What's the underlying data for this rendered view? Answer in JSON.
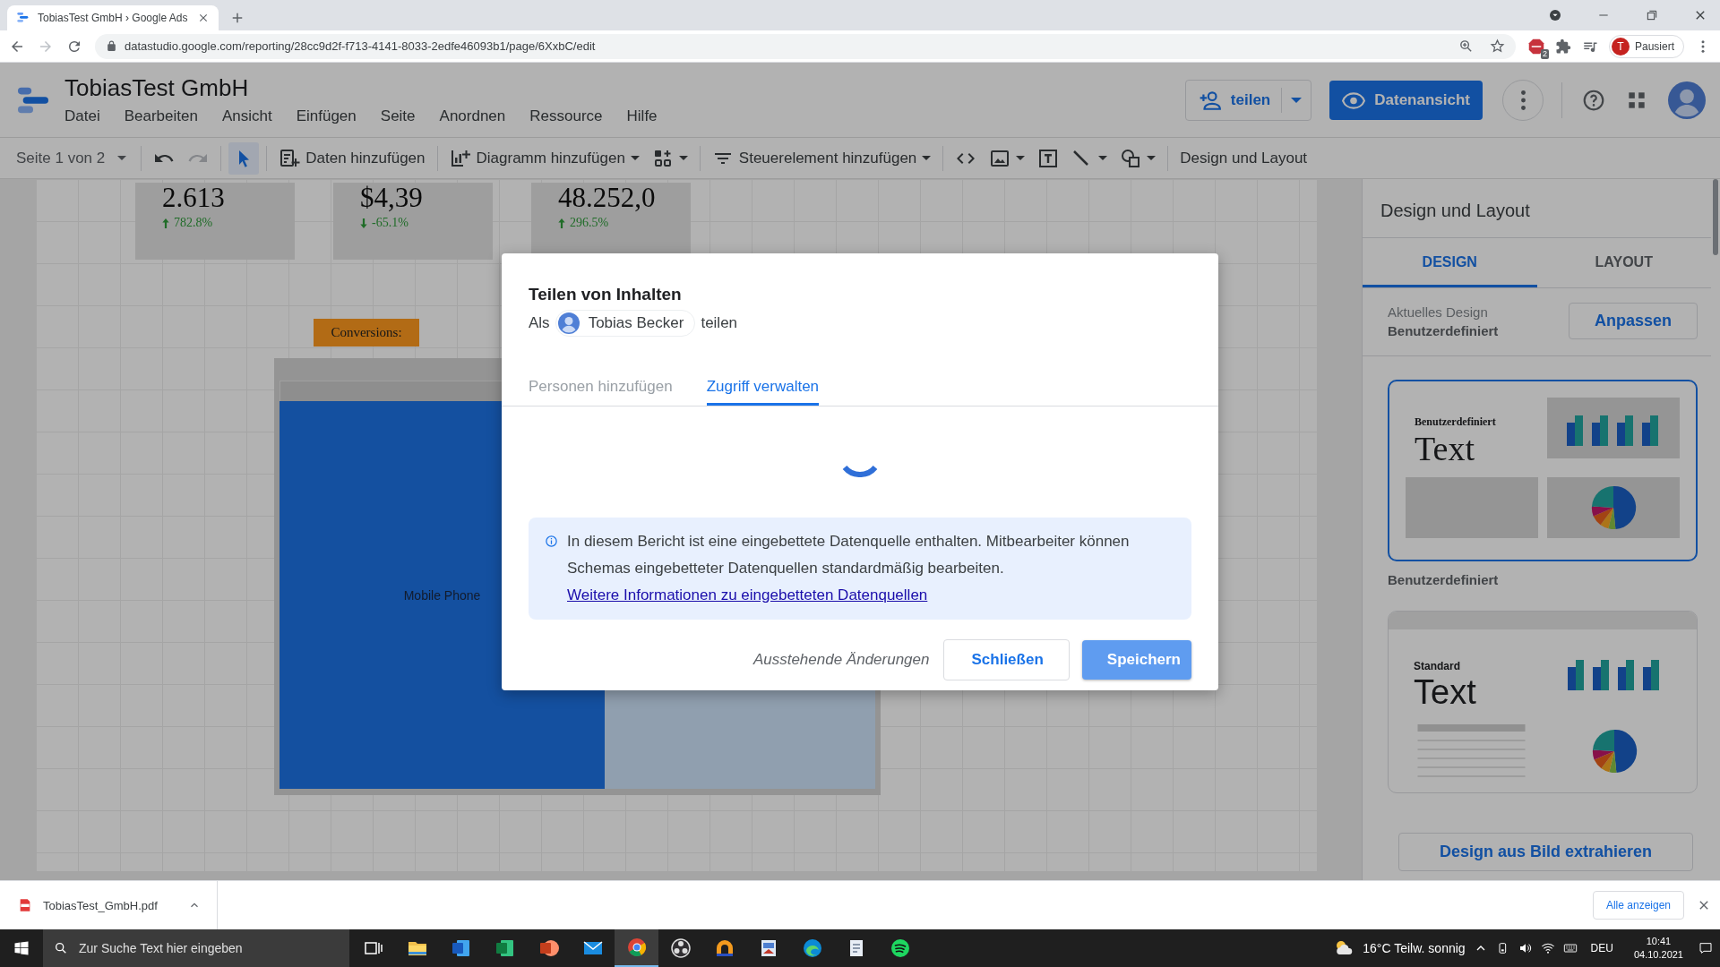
{
  "browser": {
    "tabs": [
      {
        "title": "TobiasTest GmbH › Google Ads",
        "selected": true
      }
    ],
    "url": "datastudio.google.com/reporting/28cc9d2f-f713-4141-8033-2edfe46093b1/page/6XxbC/edit",
    "extension_badge": "2",
    "profile": {
      "initial": "T",
      "label": "Pausiert"
    }
  },
  "app": {
    "title": "TobiasTest GmbH",
    "menu": [
      "Datei",
      "Bearbeiten",
      "Ansicht",
      "Einfügen",
      "Seite",
      "Anordnen",
      "Ressource",
      "Hilfe"
    ],
    "share_button": "teilen",
    "view_button": "Datenansicht"
  },
  "toolbar": {
    "page_selector": "Seite 1 von 2",
    "tool_groups": [
      [
        {
          "kind": "undo",
          "dropdown": false,
          "selected": false,
          "disabled": false
        },
        {
          "kind": "redo",
          "dropdown": false,
          "selected": false,
          "disabled": true
        }
      ],
      [
        {
          "kind": "pointer",
          "dropdown": false,
          "selected": true,
          "disabled": false
        }
      ],
      [
        {
          "kind": "add_data",
          "label": "Daten hinzufügen",
          "dropdown": false,
          "selected": false,
          "disabled": false
        }
      ],
      [
        {
          "kind": "add_chart",
          "label": "Diagramm hinzufügen",
          "dropdown": true,
          "selected": false,
          "disabled": false
        },
        {
          "kind": "components",
          "dropdown": true,
          "selected": false,
          "disabled": false
        }
      ],
      [
        {
          "kind": "controls",
          "label": "Steuerelement hinzufügen",
          "dropdown": true,
          "selected": false,
          "disabled": false
        }
      ],
      [
        {
          "kind": "code",
          "dropdown": false,
          "selected": false,
          "disabled": false
        },
        {
          "kind": "image",
          "dropdown": true,
          "selected": false,
          "disabled": false
        },
        {
          "kind": "text",
          "dropdown": false,
          "selected": false,
          "disabled": false
        },
        {
          "kind": "line",
          "dropdown": true,
          "selected": false,
          "disabled": false
        },
        {
          "kind": "shape",
          "dropdown": true,
          "selected": false,
          "disabled": false
        }
      ],
      [
        {
          "kind": "theme",
          "label": "Design und Layout",
          "dropdown": false,
          "selected": false,
          "disabled": false
        }
      ]
    ]
  },
  "canvas": {
    "scorecards": [
      {
        "value": "2.613",
        "change": "782.8%",
        "rising": true
      },
      {
        "value": "$4,39",
        "change": "-65.1%",
        "rising": false
      },
      {
        "value": "48.252,0",
        "change": "296.5%",
        "rising": true
      }
    ],
    "section_label": "Conversions:",
    "treemap": {
      "label": "Mobile Phone"
    }
  },
  "dialog": {
    "title": "Teilen von Inhalten",
    "as_prefix": "Als",
    "user": "Tobias Becker",
    "as_suffix": "teilen",
    "tabs": [
      {
        "label": "Personen hinzufügen",
        "selected": false
      },
      {
        "label": "Zugriff verwalten",
        "selected": true
      }
    ],
    "loading": true,
    "info": {
      "text": "In diesem Bericht ist eine eingebettete Datenquelle enthalten. Mitbearbeiter können Schemas eingebetteter Datenquellen standardmäßig bearbeiten.",
      "link": "Weitere Informationen zu eingebetteten Datenquellen"
    },
    "status": "Ausstehende Änderungen",
    "buttons": [
      {
        "label": "Schließen",
        "kind": "secondary"
      },
      {
        "label": "Speichern",
        "kind": "primary"
      }
    ]
  },
  "panel": {
    "title": "Design und Layout",
    "tabs": [
      {
        "label": "DESIGN",
        "selected": true
      },
      {
        "label": "LAYOUT",
        "selected": false
      }
    ],
    "current_label": "Aktuelles Design",
    "current_value": "Benutzerdefiniert",
    "customize_button": "Anpassen",
    "themes": [
      {
        "kind": "custom",
        "heading": "Benutzerdefiniert",
        "sample": "Text",
        "caption": "Benutzerdefiniert",
        "selected": true
      },
      {
        "kind": "standard",
        "heading": "Standard",
        "sample": "Text",
        "selected": false
      }
    ],
    "extract_button": "Design aus Bild extrahieren"
  },
  "download_bar": {
    "file": "TobiasTest_GmbH.pdf",
    "show_all": "Alle anzeigen"
  },
  "taskbar": {
    "search_placeholder": "Zur Suche Text hier eingeben",
    "apps": [
      {
        "kind": "taskview",
        "active": false
      },
      {
        "kind": "folder",
        "active": false
      },
      {
        "kind": "document",
        "active": false
      },
      {
        "kind": "spreadsheet",
        "active": false
      },
      {
        "kind": "slides",
        "active": false
      },
      {
        "kind": "mail",
        "active": false
      },
      {
        "kind": "browser",
        "active": true
      },
      {
        "kind": "aperture",
        "active": false
      },
      {
        "kind": "arch",
        "active": false
      },
      {
        "kind": "paint",
        "active": false
      },
      {
        "kind": "wave",
        "active": false
      },
      {
        "kind": "notepad",
        "active": false
      },
      {
        "kind": "music",
        "active": false
      }
    ],
    "weather": "16°C Teilw. sonnig",
    "language": "DEU",
    "time": "10:41",
    "date": "04.10.2021"
  }
}
